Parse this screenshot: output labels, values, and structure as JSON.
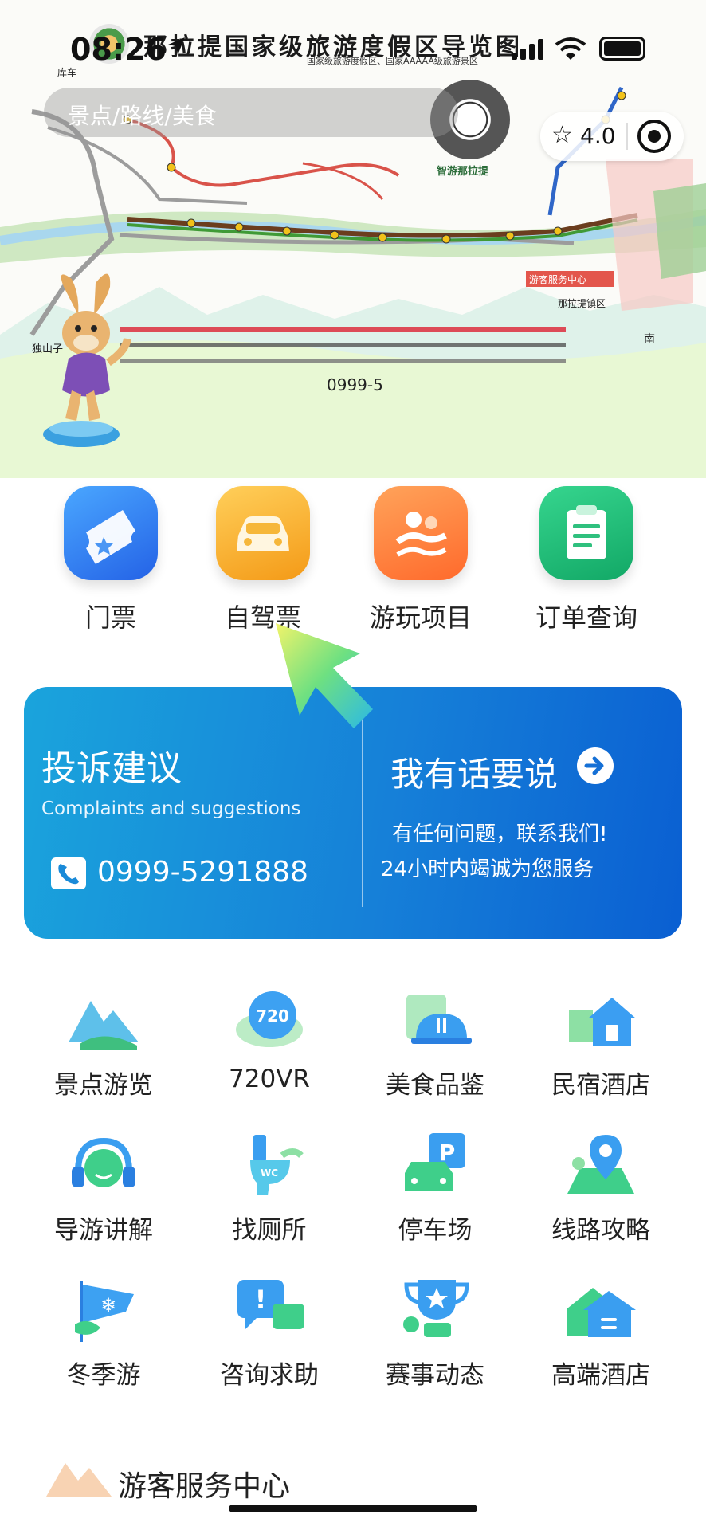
{
  "status_bar": {
    "time": "08:26"
  },
  "map": {
    "title": "那拉提国家级旅游度假区导览图",
    "subtitle": "国家级旅游度假区、国家AAAAA级旅游景区",
    "qr_label": "智游那拉提",
    "station_labels": [
      "库车",
      "游客服务中心",
      "独山子",
      "那拉提镇区",
      "南"
    ],
    "phone_text": "0999-5"
  },
  "search": {
    "placeholder": "景点/路线/美食"
  },
  "rating": {
    "value": "4.0"
  },
  "main_menu": [
    {
      "label": "门票",
      "icon": "ticket-icon"
    },
    {
      "label": "自驾票",
      "icon": "car-icon"
    },
    {
      "label": "游玩项目",
      "icon": "rafting-icon"
    },
    {
      "label": "订单查询",
      "icon": "clipboard-icon"
    }
  ],
  "banner": {
    "title": "投诉建议",
    "subtitle": "Complaints and suggestions",
    "phone": "0999-5291888",
    "cta": "我有话要说",
    "desc1": "有任何问题，联系我们!",
    "desc2": "24小时内竭诚为您服务"
  },
  "services": [
    {
      "label": "景点游览",
      "icon": "mountain-icon"
    },
    {
      "label": "720VR",
      "icon": "vr-720-icon"
    },
    {
      "label": "美食品鉴",
      "icon": "food-cloche-icon"
    },
    {
      "label": "民宿酒店",
      "icon": "house-icon"
    },
    {
      "label": "导游讲解",
      "icon": "headphones-icon"
    },
    {
      "label": "找厕所",
      "icon": "toilet-icon"
    },
    {
      "label": "停车场",
      "icon": "parking-icon"
    },
    {
      "label": "线路攻略",
      "icon": "map-pin-icon"
    },
    {
      "label": "冬季游",
      "icon": "snowflake-flag-icon"
    },
    {
      "label": "咨询求助",
      "icon": "chat-bubble-icon"
    },
    {
      "label": "赛事动态",
      "icon": "trophy-icon"
    },
    {
      "label": "高端酒店",
      "icon": "hotel-icon"
    }
  ],
  "section": {
    "title": "游客服务中心"
  },
  "colors": {
    "accent_blue": "#1680d8",
    "ticket_blue": "#2f7df0",
    "car_orange": "#f7a21b",
    "rafting_orange": "#ff7a3d",
    "order_green": "#1fbf7a"
  }
}
